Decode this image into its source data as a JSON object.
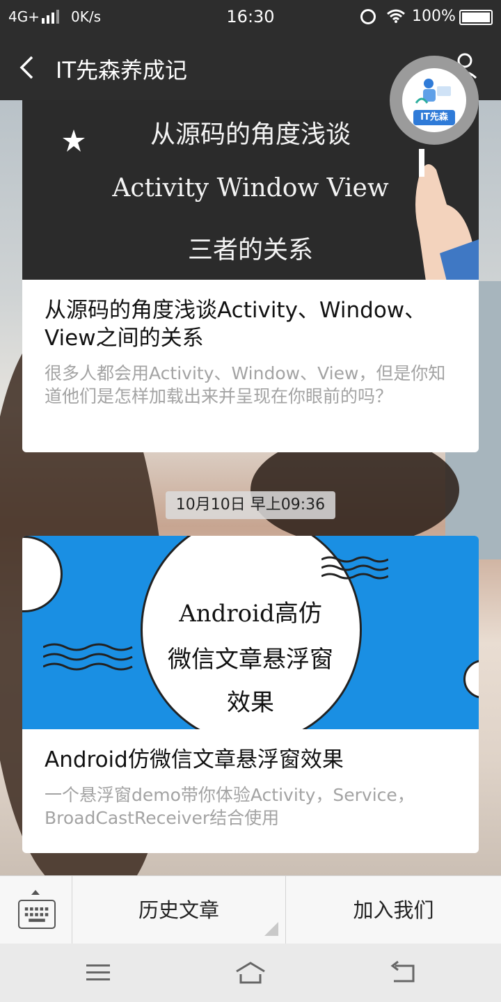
{
  "status_bar": {
    "network": "4G+",
    "speed": "0K/s",
    "time": "16:30",
    "battery": "100%"
  },
  "header": {
    "title": "IT先森养成记",
    "back_icon": "chevron-left-icon",
    "profile_icon": "person-icon"
  },
  "articles": [
    {
      "cover_lines": [
        "从源码的角度浅谈",
        "Activity Window View",
        "三者的关系"
      ],
      "title": "从源码的角度浅谈Activity、Window、View之间的关系",
      "desc": "很多人都会用Activity、Window、View，但是你知道他们是怎样加载出来并呈现在你眼前的吗？"
    },
    {
      "cover_lines": [
        "Android高仿",
        "微信文章悬浮窗",
        "效果"
      ],
      "title": "Android仿微信文章悬浮窗效果",
      "desc": "一个悬浮窗demo带你体验Activity，Service，BroadCastReceiver结合使用"
    }
  ],
  "timestamp": "10月10日 早上09:36",
  "floating_avatar": {
    "badge": "IT先森"
  },
  "menu": {
    "keyboard_icon": "keyboard-icon",
    "item1": "历史文章",
    "item2": "加入我们"
  },
  "nav": {
    "menu_icon": "menu-icon",
    "home_icon": "home-icon",
    "back_icon": "return-icon"
  },
  "colors": {
    "dark_bar": "#2d2d2d",
    "cover2_blue": "#1a8fe3",
    "badge_blue": "#2f7bd8"
  }
}
